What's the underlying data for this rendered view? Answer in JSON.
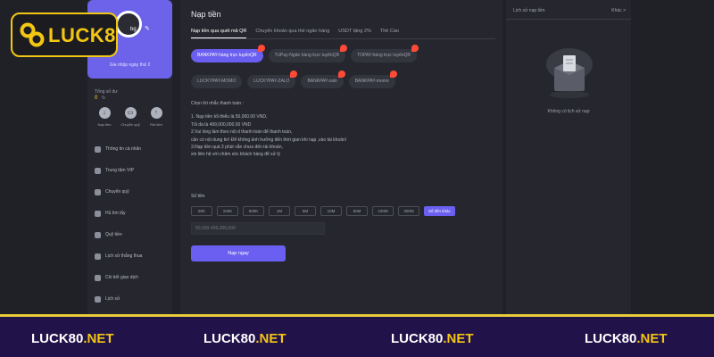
{
  "logo": {
    "text": "LUCK8"
  },
  "sidebar": {
    "profile_name": "bg",
    "profile_sub": "Gia nhập ngày thứ 2",
    "balance_label": "Tổng số dư",
    "balance_value": "0",
    "wallet_actions": [
      {
        "label": "Nạp tiền",
        "icon": "deposit-icon"
      },
      {
        "label": "Chuyển quỹ",
        "icon": "wallet-icon"
      },
      {
        "label": "Rút tiền",
        "icon": "withdraw-icon"
      }
    ],
    "menu": [
      {
        "label": "Thông tin cá nhân",
        "icon": "user-icon"
      },
      {
        "label": "Trung tâm VIP",
        "icon": "vip-icon"
      },
      {
        "label": "Chuyển quỹ",
        "icon": "transfer-icon"
      },
      {
        "label": "Hủ tìm lấy",
        "icon": "refund-icon"
      },
      {
        "label": "Quỹ tiền",
        "icon": "fund-icon"
      },
      {
        "label": "Lịch sử thắng thua",
        "icon": "history-icon"
      },
      {
        "label": "Chi tiết giao dịch",
        "icon": "transaction-icon"
      },
      {
        "label": "Lịch sử",
        "icon": "record-icon"
      }
    ]
  },
  "main": {
    "title": "Nạp tiền",
    "tabs": [
      {
        "label": "Nạp tiền qua quét mã QR",
        "active": true
      },
      {
        "label": "Chuyển khoản qua thẻ ngân hàng",
        "active": false
      },
      {
        "label": "USDT tặng 2%",
        "active": false
      },
      {
        "label": "Thẻ Cào",
        "active": false
      }
    ],
    "pay_methods_row1": [
      {
        "label": "BANKPAY-hàng trực tuyếnQR",
        "active": true
      },
      {
        "label": "7UPay-Ngân hàng trực tuyếnQR",
        "active": false
      },
      {
        "label": "TOPAY-hàng trực tuyếnQR",
        "active": false
      }
    ],
    "pay_methods_row2": [
      {
        "label": "LUCKYPAY-MOMO",
        "active": false
      },
      {
        "label": "LUCKYPAY-ZALO",
        "active": false
      },
      {
        "label": "BANKPAY-zalo",
        "active": false
      },
      {
        "label": "BANKPAY-momo",
        "active": false
      }
    ],
    "info_heading": "Chọn lời nhắc thanh toán :",
    "info_lines": [
      "1. Nạp tiền tối thiểu là 50,000.00 VND,",
      "Tối đa là 499,000,000.00 VND",
      "2.Vui lòng làm theo nội d thanh toán để thanh toán,",
      "cần có nội dung tin! Để không ảnh hưởng đến thời gian khi nạp ,vào tài khoản!",
      "3.Nạp tiền quá 3 phút vẫn chưa đến tài khoản,",
      "xin liên hệ với chăm sóc khách hàng để xử lý"
    ],
    "amount_label": "Số tiền",
    "amounts": [
      "50K",
      "100K",
      "500K",
      "1M",
      "5M",
      "10M",
      "50M",
      "100M",
      "300M"
    ],
    "amount_other": "Số tiền khác",
    "amount_placeholder": "50,000-499,000,000",
    "submit_label": "Nạp ngay"
  },
  "history": {
    "title": "Lịch sử nạp tiền",
    "more": "Khác >",
    "empty_text": "Không có lịch sử nạp"
  },
  "footer": {
    "items": [
      {
        "brand": "LUCK80",
        "tld": ".NET"
      },
      {
        "brand": "LUCK80",
        "tld": ".NET"
      },
      {
        "brand": "LUCK80",
        "tld": ".NET"
      },
      {
        "brand": "LUCK80",
        "tld": ".NET"
      }
    ]
  },
  "colors": {
    "accent": "#6a5ff0",
    "brand_gold": "#f3c614",
    "footer_bg": "#22124a"
  }
}
